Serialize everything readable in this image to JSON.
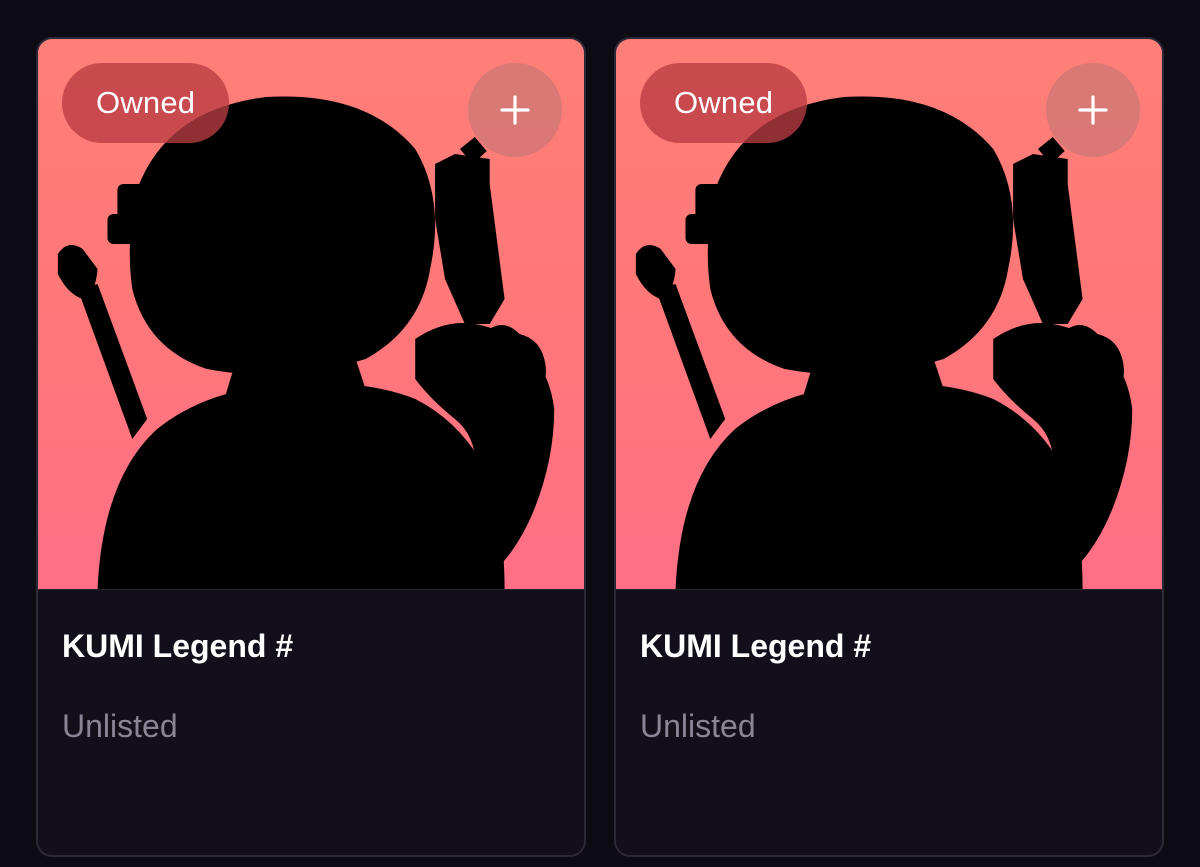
{
  "cards": [
    {
      "badge": "Owned",
      "add_icon": "plus-icon",
      "title": "KUMI Legend #",
      "status": "Unlisted"
    },
    {
      "badge": "Owned",
      "add_icon": "plus-icon",
      "title": "KUMI Legend #",
      "status": "Unlisted"
    }
  ],
  "colors": {
    "page_bg": "#0c0a13",
    "card_bg": "#120e1a",
    "art_gradient_top": "#ff7f78",
    "art_gradient_bottom": "#ff6f86",
    "badge_bg": "#b93c42",
    "status_text": "#8a8494"
  }
}
